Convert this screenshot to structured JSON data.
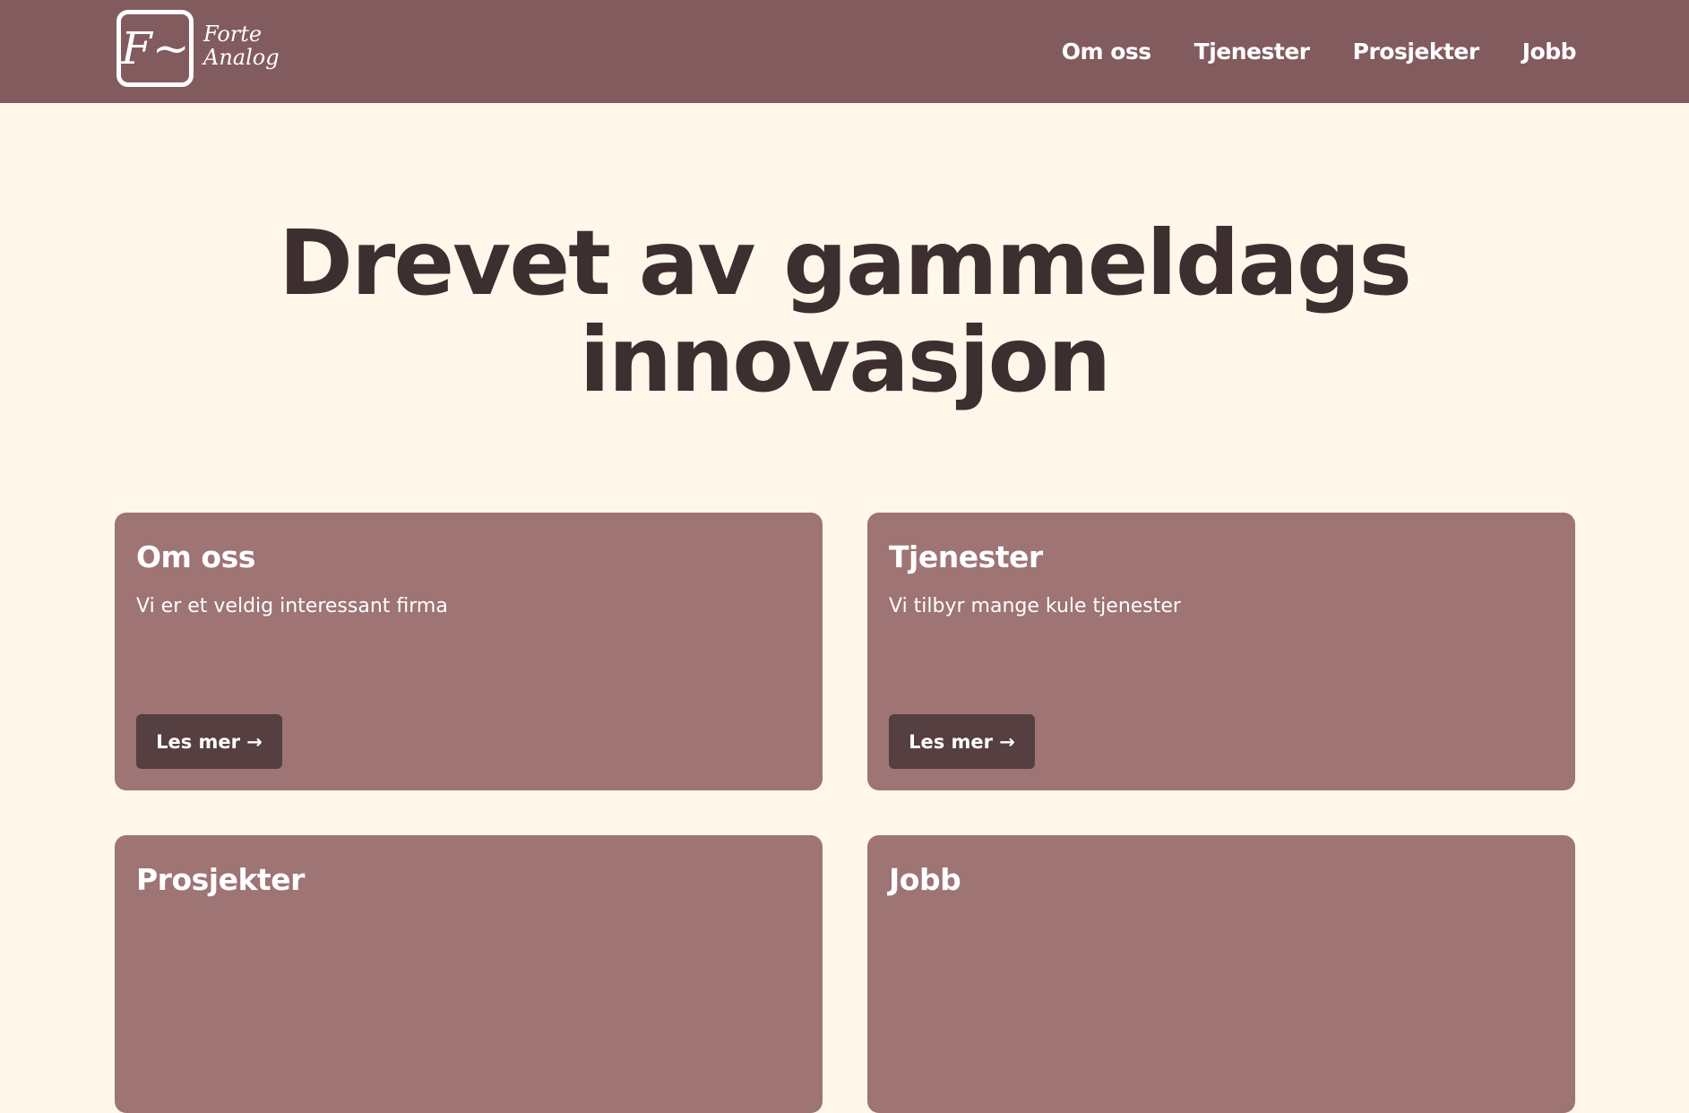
{
  "header": {
    "logo": {
      "glyph": "F~",
      "line1": "Forte",
      "line2": "Analog"
    },
    "nav": [
      {
        "label": "Om oss"
      },
      {
        "label": "Tjenester"
      },
      {
        "label": "Prosjekter"
      },
      {
        "label": "Jobb"
      }
    ]
  },
  "hero": {
    "line1": "Drevet av gammeldags",
    "line2": "innovasjon"
  },
  "cards": [
    {
      "title": "Om oss",
      "text": "Vi er et veldig interessant firma",
      "button": "Les mer →"
    },
    {
      "title": "Tjenester",
      "text": "Vi tilbyr mange kule tjenester",
      "button": "Les mer →"
    },
    {
      "title": "Prosjekter",
      "text": "",
      "button": ""
    },
    {
      "title": "Jobb",
      "text": "",
      "button": ""
    }
  ],
  "colors": {
    "header": "#825b5e",
    "background": "#fff7ea",
    "card": "#9e7474",
    "button": "#563f41",
    "heading": "#3d2e2f"
  }
}
